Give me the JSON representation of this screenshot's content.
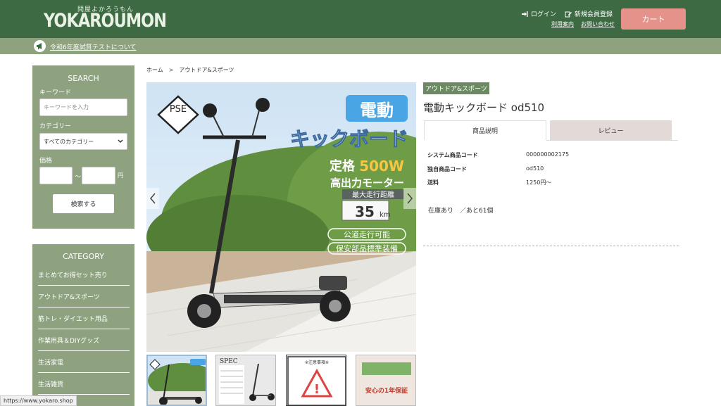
{
  "header": {
    "logo_sub": "問屋よかろうもん",
    "logo": "YOKAROUMON",
    "login": "ログイン",
    "register": "新規会員登録",
    "guide": "利用案内",
    "contact": "お問い合わせ",
    "cart": "カート"
  },
  "notice": {
    "text": "令和6年度試質テストについて"
  },
  "search": {
    "title": "SEARCH",
    "keyword_label": "キーワード",
    "keyword_placeholder": "キーワードを入力",
    "category_label": "カテゴリー",
    "category_selected": "すべてのカテゴリー",
    "price_label": "価格",
    "price_sep": "～",
    "price_unit": "円",
    "button": "検索する"
  },
  "category": {
    "title": "CATEGORY",
    "items": [
      "まとめてお得セット売り",
      "アウトドア&スポーツ",
      "筋トレ・ダイエット用品",
      "作業用具＆DIYグッズ",
      "生活家電",
      "生活雑貨"
    ]
  },
  "breadcrumb": {
    "home": "ホーム",
    "sep": ">",
    "current": "アウトドア&スポーツ"
  },
  "product": {
    "tag": "アウトドア&スポーツ",
    "title": "電動キックボード od510",
    "tab_desc": "商品説明",
    "tab_review": "レビュー",
    "specs": [
      {
        "label": "システム商品コード",
        "value": "000000002175"
      },
      {
        "label": "独自商品コード",
        "value": "od510"
      },
      {
        "label": "送料",
        "value": "1250円～"
      }
    ],
    "stock": "在庫あり　／あと61個"
  },
  "image": {
    "pse": "PSE",
    "badge": "電動",
    "headline": "キックボード",
    "power_prefix": "定格",
    "power": "500W",
    "motor": "高出力モーター",
    "range_label": "最大走行距離",
    "range": "35",
    "range_unit": "km",
    "road": "公道走行可能",
    "parts": "保安部品標準装備"
  },
  "thumbs": {
    "t2_title": "SPEC",
    "t3_title": "※注意事項※",
    "t4_text": "安心の1年保証"
  },
  "status_bar": "https://www.yokaro.shop"
}
